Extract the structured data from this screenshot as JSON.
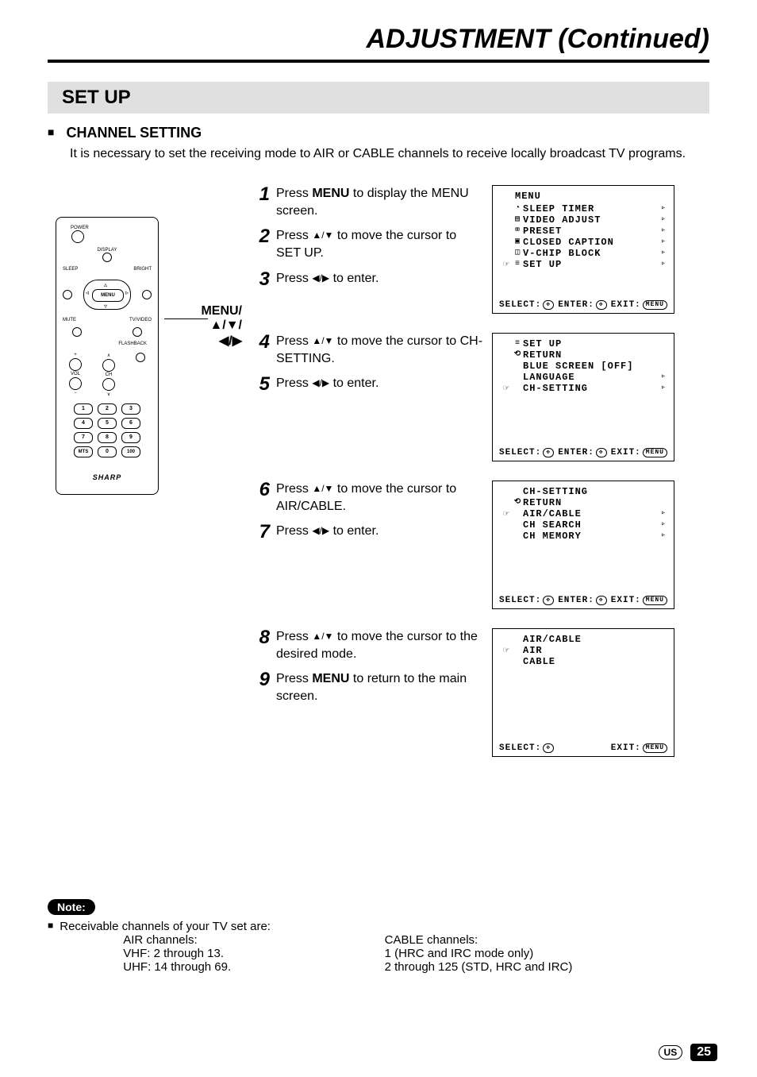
{
  "page_title": "ADJUSTMENT (Continued)",
  "section_bar": "SET UP",
  "channel_heading": "CHANNEL SETTING",
  "intro": "It is necessary to set the receiving mode to AIR or CABLE channels to receive locally broadcast TV programs.",
  "callout": {
    "line1": "MENU/",
    "line2": "▲/▼/",
    "line3": "◀/▶"
  },
  "remote": {
    "labels": {
      "power": "POWER",
      "display": "DISPLAY",
      "sleep": "SLEEP",
      "bright": "BRIGHT",
      "menu": "MENU",
      "mute": "MUTE",
      "tvvideo": "TV/VIDEO",
      "flashback": "FLASHBACK",
      "vol": "VOL",
      "ch": "CH",
      "mts": "MTS",
      "brand": "SHARP"
    },
    "numkeys": [
      [
        "1",
        "2",
        "3"
      ],
      [
        "4",
        "5",
        "6"
      ],
      [
        "7",
        "8",
        "9"
      ],
      [
        "MTS",
        "0",
        "100"
      ]
    ]
  },
  "groups": [
    {
      "steps": [
        {
          "n": "1",
          "pre": "Press ",
          "bold": "MENU",
          "post": " to display the MENU screen."
        },
        {
          "n": "2",
          "pre": "Press ",
          "sym": "▲/▼",
          "post": " to move the cursor to SET UP."
        },
        {
          "n": "3",
          "pre": "Press ",
          "sym": "◀/▶",
          "post": " to enter."
        }
      ],
      "osd": {
        "title": "MENU",
        "items": [
          {
            "pointer": "",
            "ico": "◔",
            "lab": "SLEEP TIMER",
            "arr": "▹"
          },
          {
            "pointer": "",
            "ico": "▤",
            "lab": "VIDEO ADJUST",
            "arr": "▹"
          },
          {
            "pointer": "",
            "ico": "⌧",
            "lab": "PRESET",
            "arr": "▹"
          },
          {
            "pointer": "",
            "ico": "▣",
            "lab": "CLOSED CAPTION",
            "arr": "▹"
          },
          {
            "pointer": "",
            "ico": "◫",
            "lab": "V-CHIP BLOCK",
            "arr": "▹"
          },
          {
            "pointer": "☞",
            "ico": "≡",
            "lab": "SET UP",
            "arr": "▹"
          }
        ],
        "footer": {
          "select": "SELECT:",
          "enter": "ENTER:",
          "exit": "EXIT:",
          "has_enter": true
        }
      }
    },
    {
      "steps": [
        {
          "n": "4",
          "pre": "Press ",
          "sym": "▲/▼",
          "post": " to move the cursor to CH-SETTING."
        },
        {
          "n": "5",
          "pre": "Press ",
          "sym": "◀/▶",
          "post": " to enter."
        }
      ],
      "osd": {
        "title": "",
        "items": [
          {
            "pointer": "",
            "ico": "≡",
            "lab": "SET UP",
            "arr": ""
          },
          {
            "pointer": "",
            "ico": "⟲",
            "lab": "RETURN",
            "arr": ""
          },
          {
            "pointer": "",
            "ico": "",
            "lab": "BLUE SCREEN [OFF]",
            "arr": ""
          },
          {
            "pointer": "",
            "ico": "",
            "lab": "LANGUAGE",
            "arr": "▹"
          },
          {
            "pointer": "☞",
            "ico": "",
            "lab": "CH-SETTING",
            "arr": "▹"
          }
        ],
        "footer": {
          "select": "SELECT:",
          "enter": "ENTER:",
          "exit": "EXIT:",
          "has_enter": true
        }
      }
    },
    {
      "steps": [
        {
          "n": "6",
          "pre": "Press ",
          "sym": "▲/▼",
          "post": " to move the cursor to AIR/CABLE."
        },
        {
          "n": "7",
          "pre": "Press ",
          "sym": "◀/▶",
          "post": " to enter."
        }
      ],
      "osd": {
        "title": "",
        "items": [
          {
            "pointer": "",
            "ico": "",
            "lab": "CH-SETTING",
            "arr": ""
          },
          {
            "pointer": "",
            "ico": "⟲",
            "lab": "RETURN",
            "arr": ""
          },
          {
            "pointer": "☞",
            "ico": "",
            "lab": "AIR/CABLE",
            "arr": "▹"
          },
          {
            "pointer": "",
            "ico": "",
            "lab": "CH SEARCH",
            "arr": "▹"
          },
          {
            "pointer": "",
            "ico": "",
            "lab": "CH MEMORY",
            "arr": "▹"
          }
        ],
        "footer": {
          "select": "SELECT:",
          "enter": "ENTER:",
          "exit": "EXIT:",
          "has_enter": true
        }
      }
    },
    {
      "steps": [
        {
          "n": "8",
          "pre": "Press ",
          "sym": "▲/▼",
          "post": " to move the cursor to the desired mode."
        },
        {
          "n": "9",
          "pre": "Press ",
          "bold": "MENU",
          "post": " to return to the main screen."
        }
      ],
      "osd": {
        "title": "",
        "items": [
          {
            "pointer": "",
            "ico": "",
            "lab": "AIR/CABLE",
            "arr": ""
          },
          {
            "pointer": "☞",
            "ico": "",
            "lab": "AIR",
            "arr": ""
          },
          {
            "pointer": "",
            "ico": "",
            "lab": "CABLE",
            "arr": ""
          }
        ],
        "footer": {
          "select": "SELECT:",
          "enter": "",
          "exit": "EXIT:",
          "has_enter": false
        }
      }
    }
  ],
  "note": {
    "label": "Note:",
    "lead": "Receivable channels of your TV set are:",
    "air": {
      "hdr": "AIR channels:",
      "l1": "VHF: 2 through 13.",
      "l2": "UHF: 14 through 69."
    },
    "cable": {
      "hdr": "CABLE channels:",
      "l1": "1 (HRC and IRC mode only)",
      "l2": "2 through 125 (STD, HRC and IRC)"
    }
  },
  "footer": {
    "region": "US",
    "page": "25"
  }
}
